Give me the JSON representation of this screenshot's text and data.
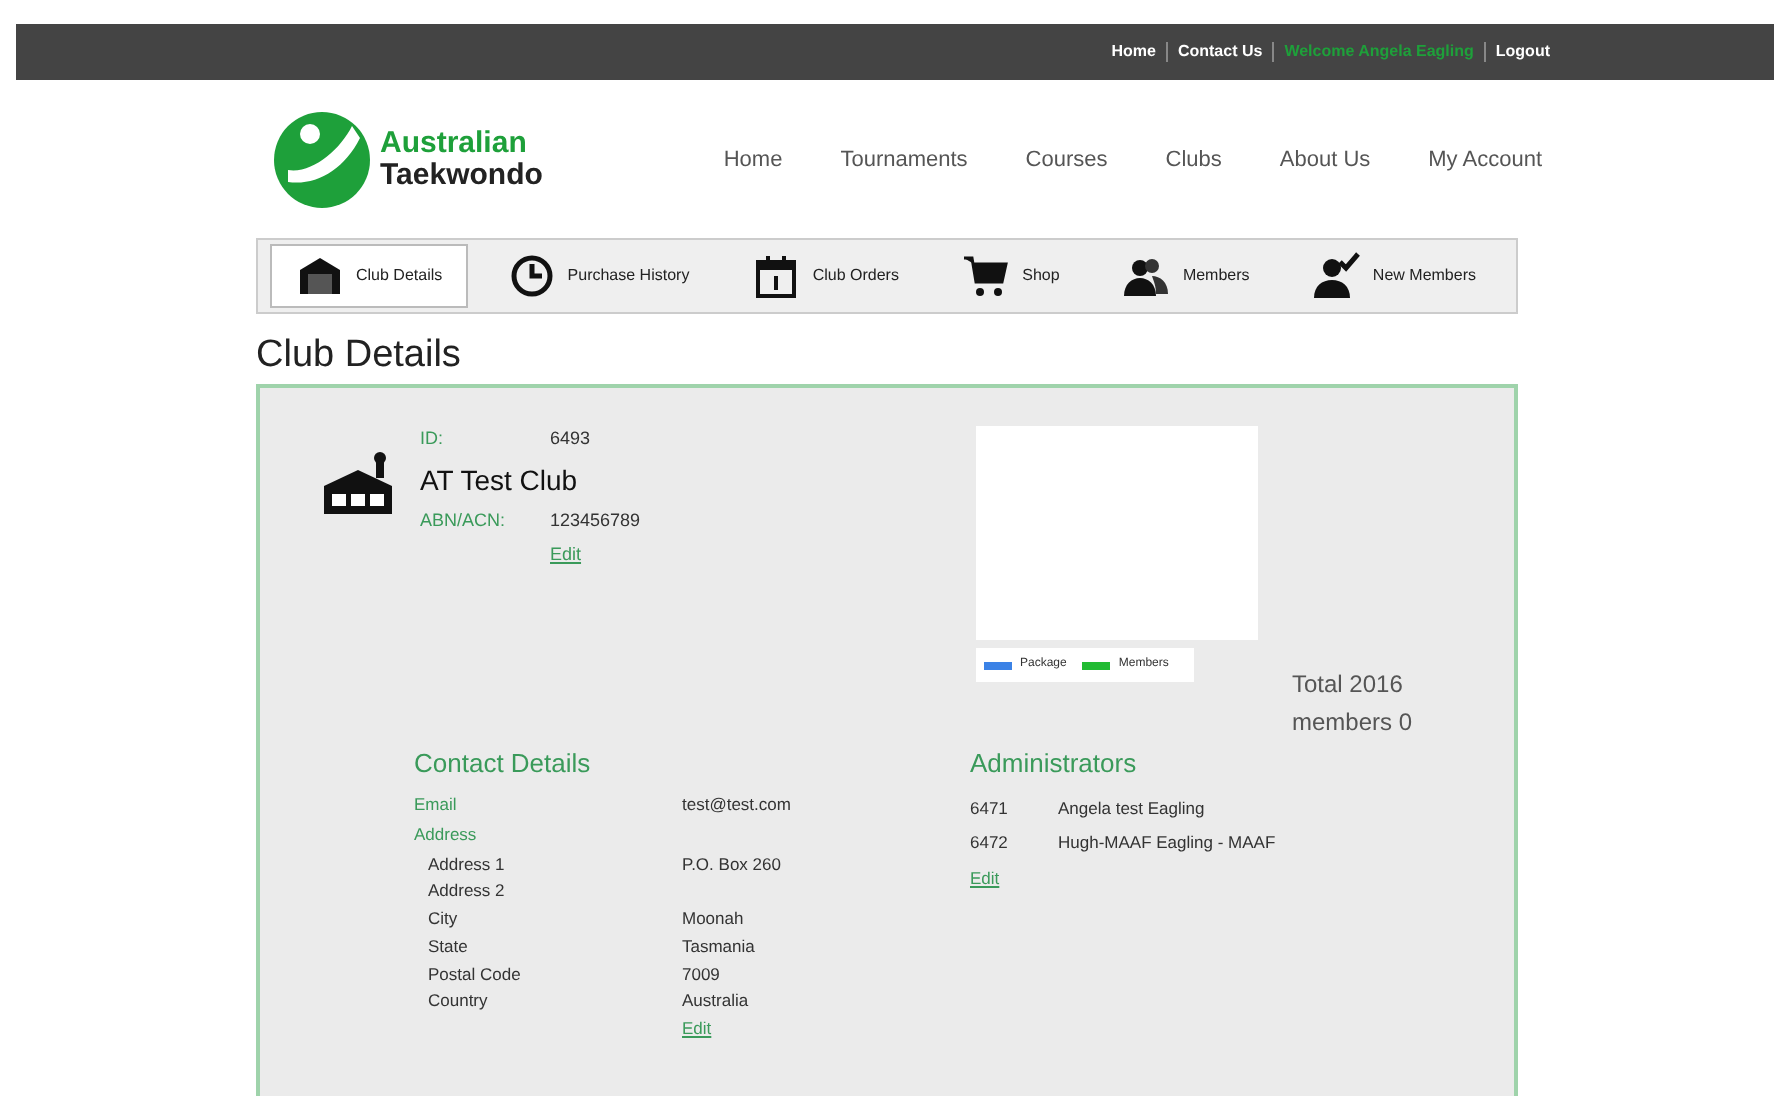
{
  "top_bar": {
    "links": [
      {
        "label": "Home",
        "kind": "link"
      },
      {
        "label": "Contact Us",
        "kind": "link"
      },
      {
        "label": "Welcome Angela Eagling",
        "kind": "greeting"
      },
      {
        "label": "Logout",
        "kind": "link"
      }
    ]
  },
  "logo": {
    "line1": "Australian",
    "line2": "Taekwondo"
  },
  "main_nav": [
    "Home",
    "Tournaments",
    "Courses",
    "Clubs",
    "About Us",
    "My Account"
  ],
  "tabs": [
    {
      "label": "Club Details",
      "selected": true
    },
    {
      "label": "Purchase History",
      "selected": false
    },
    {
      "label": "Club Orders",
      "selected": false
    },
    {
      "label": "Shop",
      "selected": false
    },
    {
      "label": "Members",
      "selected": false
    },
    {
      "label": "New Members",
      "selected": false
    }
  ],
  "page_title": "Club Details",
  "club": {
    "id_label": "ID:",
    "id": "6493",
    "name": "AT Test Club",
    "abn_label": "ABN/ACN:",
    "abn": "123456789",
    "edit": "Edit"
  },
  "chart_legend": [
    {
      "name": "Package",
      "color": "#3b82e6"
    },
    {
      "name": "Members",
      "color": "#22bb33"
    }
  ],
  "totals": [
    "Total 2016",
    "members 0"
  ],
  "contact": {
    "title": "Contact Details",
    "email_label": "Email",
    "email": "test@test.com",
    "address_label": "Address",
    "rows": [
      {
        "label": "Address 1",
        "value": "P.O. Box 260"
      },
      {
        "label": "Address 2",
        "value": ""
      },
      {
        "label": "City",
        "value": "Moonah"
      },
      {
        "label": "State",
        "value": "Tasmania"
      },
      {
        "label": "Postal Code",
        "value": "7009"
      },
      {
        "label": "Country",
        "value": "Australia"
      }
    ],
    "edit": "Edit"
  },
  "administrators": {
    "title": "Administrators",
    "rows": [
      {
        "id": "6471",
        "name": "Angela test Eagling"
      },
      {
        "id": "6472",
        "name": "Hugh-MAAF Eagling - MAAF"
      }
    ],
    "edit": "Edit"
  }
}
